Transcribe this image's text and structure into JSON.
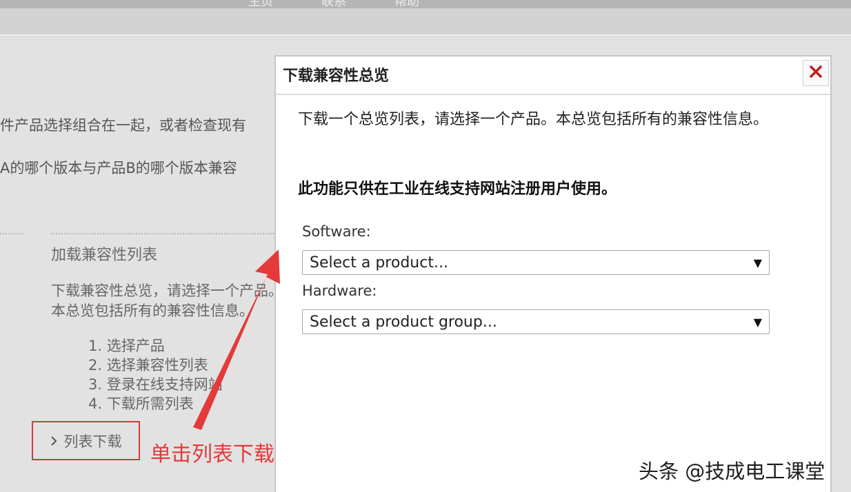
{
  "top_nav": [
    "主页",
    "联系",
    "帮助"
  ],
  "page": {
    "line1": "件产品选择组合在一起，或者检查现有",
    "line2": "A的哪个版本与产品B的哪个版本兼容",
    "section_title": "加载兼容性列表",
    "section_desc": "下载兼容性总览，请选择一个产品。本总览包括所有的兼容性信息。",
    "steps": [
      "1. 选择产品",
      "2. 选择兼容性列表",
      "3. 登录在线支持网站",
      "4. 下载所需列表"
    ],
    "list_download_button": "列表下载"
  },
  "annotation": {
    "text": "单击列表下载",
    "color": "#e5393a"
  },
  "dialog": {
    "title": "下载兼容性总览",
    "description": "下载一个总览列表，请选择一个产品。本总览包括所有的兼容性信息。",
    "note": "此功能只供在工业在线支持网站注册用户使用。",
    "software_label": "Software:",
    "software_select": "Select a product...",
    "hardware_label": "Hardware:",
    "hardware_select": "Select a product group...",
    "close_icon": "close-x-icon",
    "close_color": "#c41a1a"
  },
  "watermark": "头条 @技成电工课堂"
}
